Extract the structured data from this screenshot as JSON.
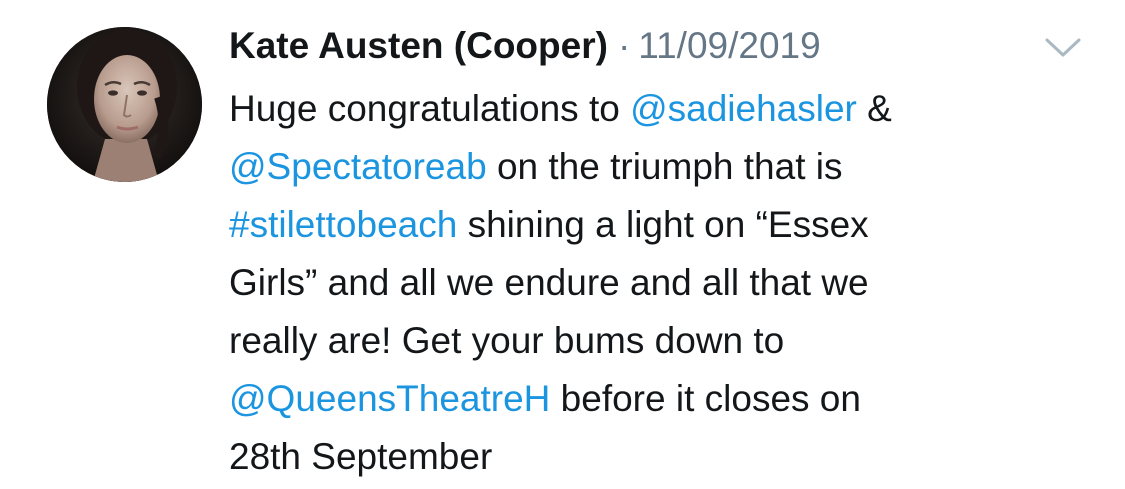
{
  "tweet": {
    "author": "Kate Austen (Cooper)",
    "separator": "·",
    "date": "11/09/2019",
    "menu_icon": "chevron-down-icon",
    "avatar_icon": "avatar-photo",
    "colors": {
      "text": "#14171a",
      "link": "#1b95e0",
      "muted": "#657786"
    },
    "lines": [
      [
        {
          "text": "Huge congratulations to ",
          "link": false
        },
        {
          "text": "@sadiehasler",
          "link": true
        },
        {
          "text": " &",
          "link": false
        }
      ],
      [
        {
          "text": "@Spectatoreab",
          "link": true
        },
        {
          "text": " on the triumph that is",
          "link": false
        }
      ],
      [
        {
          "text": "#stilettobeach",
          "link": true
        },
        {
          "text": " shining a light on “Essex",
          "link": false
        }
      ],
      [
        {
          "text": "Girls” and all we endure and all that we",
          "link": false
        }
      ],
      [
        {
          "text": "really are! Get your bums down to",
          "link": false
        }
      ],
      [
        {
          "text": "@QueensTheatreH",
          "link": true
        },
        {
          "text": " before it closes on",
          "link": false
        }
      ],
      [
        {
          "text": "28th September",
          "link": false
        }
      ]
    ]
  }
}
